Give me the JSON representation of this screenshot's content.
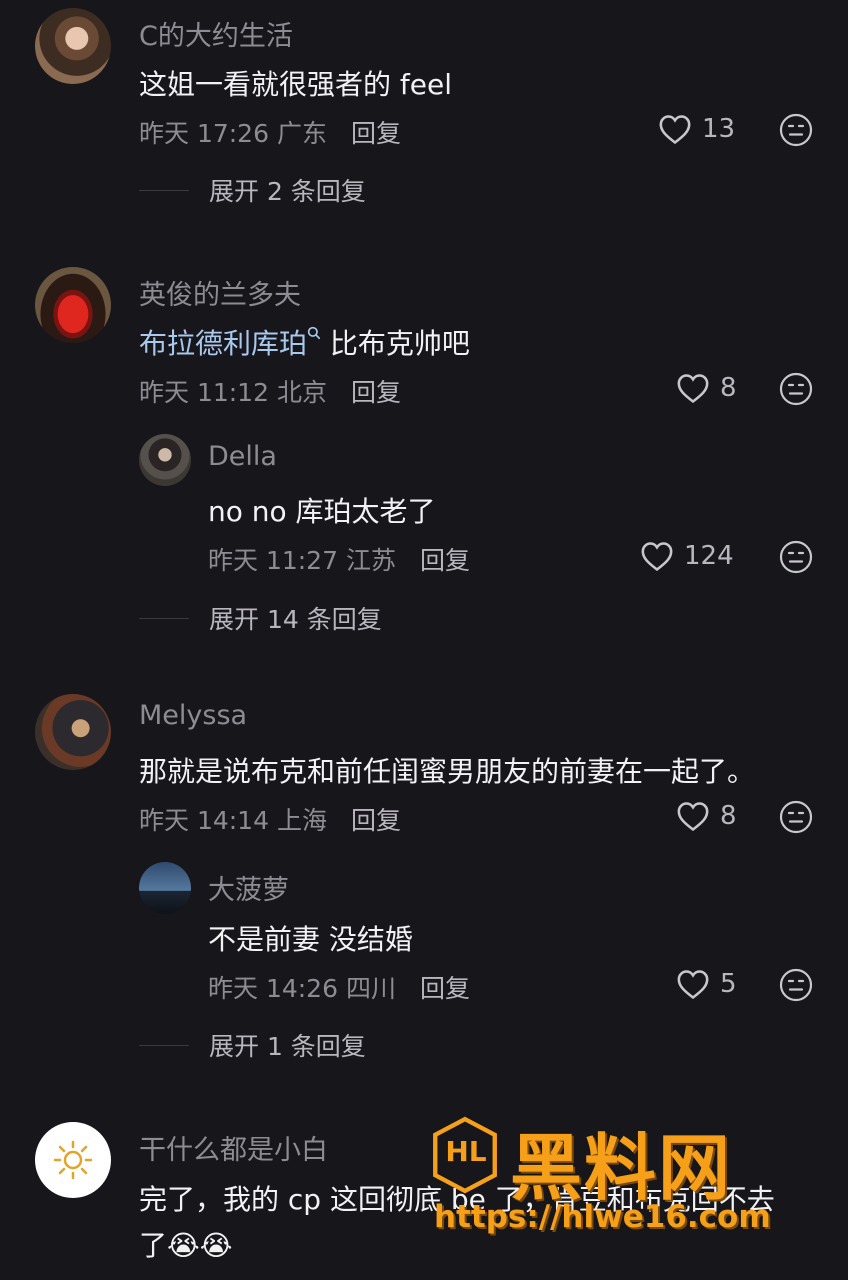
{
  "comments": [
    {
      "user": "C的大约生活",
      "text": "这姐一看就很强者的 feel",
      "meta": "昨天 17:26 广东",
      "reply_label": "回复",
      "likes": "13",
      "expand": "展开 2 条回复"
    },
    {
      "user": "英俊的兰多夫",
      "text_link": "布拉德利库珀",
      "text_rest": " 比布克帅吧",
      "meta": "昨天 11:12 北京",
      "reply_label": "回复",
      "likes": "8",
      "replies": [
        {
          "user": "Della",
          "text": "no no 库珀太老了",
          "meta": "昨天 11:27 江苏",
          "reply_label": "回复",
          "likes": "124"
        }
      ],
      "expand": "展开 14 条回复"
    },
    {
      "user": "Melyssa",
      "text": "那就是说布克和前任闺蜜男朋友的前妻在一起了。",
      "meta": "昨天 14:14 上海",
      "reply_label": "回复",
      "likes": "8",
      "replies": [
        {
          "user": "大菠萝",
          "text": "不是前妻 没结婚",
          "meta": "昨天 14:26 四川",
          "reply_label": "回复",
          "likes": "5"
        }
      ],
      "expand": "展开 1 条回复"
    },
    {
      "user": "干什么都是小白",
      "text_line1": "完了，我的 cp 这回彻底 be 了，肯豆和布克回不去",
      "text_line2": "了",
      "emoji": "😭😭"
    }
  ],
  "watermark": {
    "brand": "黑料网",
    "url": "https://hlwe16.com",
    "logo": "HL"
  },
  "icons": {
    "like": "heart-outline-icon",
    "react": "neutral-face-icon",
    "search": "search-icon",
    "sun": "sun-icon"
  },
  "colors": {
    "background": "#17161b",
    "secondary_text": "#8d8c92",
    "link": "#a8c8ee",
    "watermark_orange": "#f6a01a"
  }
}
